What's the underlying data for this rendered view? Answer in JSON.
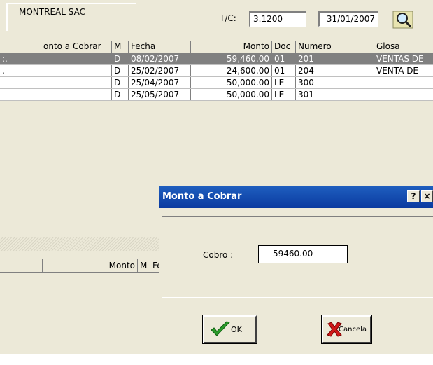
{
  "header": {
    "client_name": "MONTREAL SAC",
    "tc_label": "T/C:",
    "tc_value": "3.1200",
    "date_value": "31/01/2007",
    "search_icon": "search-magnifier-icon"
  },
  "grid": {
    "columns": [
      "",
      "onto a Cobrar",
      "M",
      "Fecha",
      "Monto",
      "Doc",
      "Numero",
      "Glosa"
    ],
    "rows": [
      {
        "c0": ":.",
        "c1": "",
        "m": "D",
        "fecha": "08/02/2007",
        "monto": "59,460.00",
        "doc": "01",
        "numero": "201",
        "glosa": "VENTAS DE"
      },
      {
        "c0": ".",
        "c1": "",
        "m": "D",
        "fecha": "25/02/2007",
        "monto": "24,600.00",
        "doc": "01",
        "numero": "204",
        "glosa": "VENTA DE"
      },
      {
        "c0": "",
        "c1": "",
        "m": "D",
        "fecha": "25/04/2007",
        "monto": "50,000.00",
        "doc": "LE",
        "numero": "300",
        "glosa": ""
      },
      {
        "c0": "",
        "c1": "",
        "m": "D",
        "fecha": "25/05/2007",
        "monto": "50,000.00",
        "doc": "LE",
        "numero": "301",
        "glosa": ""
      }
    ]
  },
  "grid2": {
    "columns": [
      "",
      "Monto",
      "M",
      "Fe"
    ]
  },
  "dialog": {
    "title": "Monto a Cobrar",
    "help_label": "?",
    "close_label": "×",
    "cobro_label": "Cobro :",
    "cobro_value": "59460.00",
    "ok_label": "OK",
    "cancel_label": "Cancela",
    "ok_icon": "checkmark-icon",
    "cancel_icon": "red-x-icon"
  }
}
